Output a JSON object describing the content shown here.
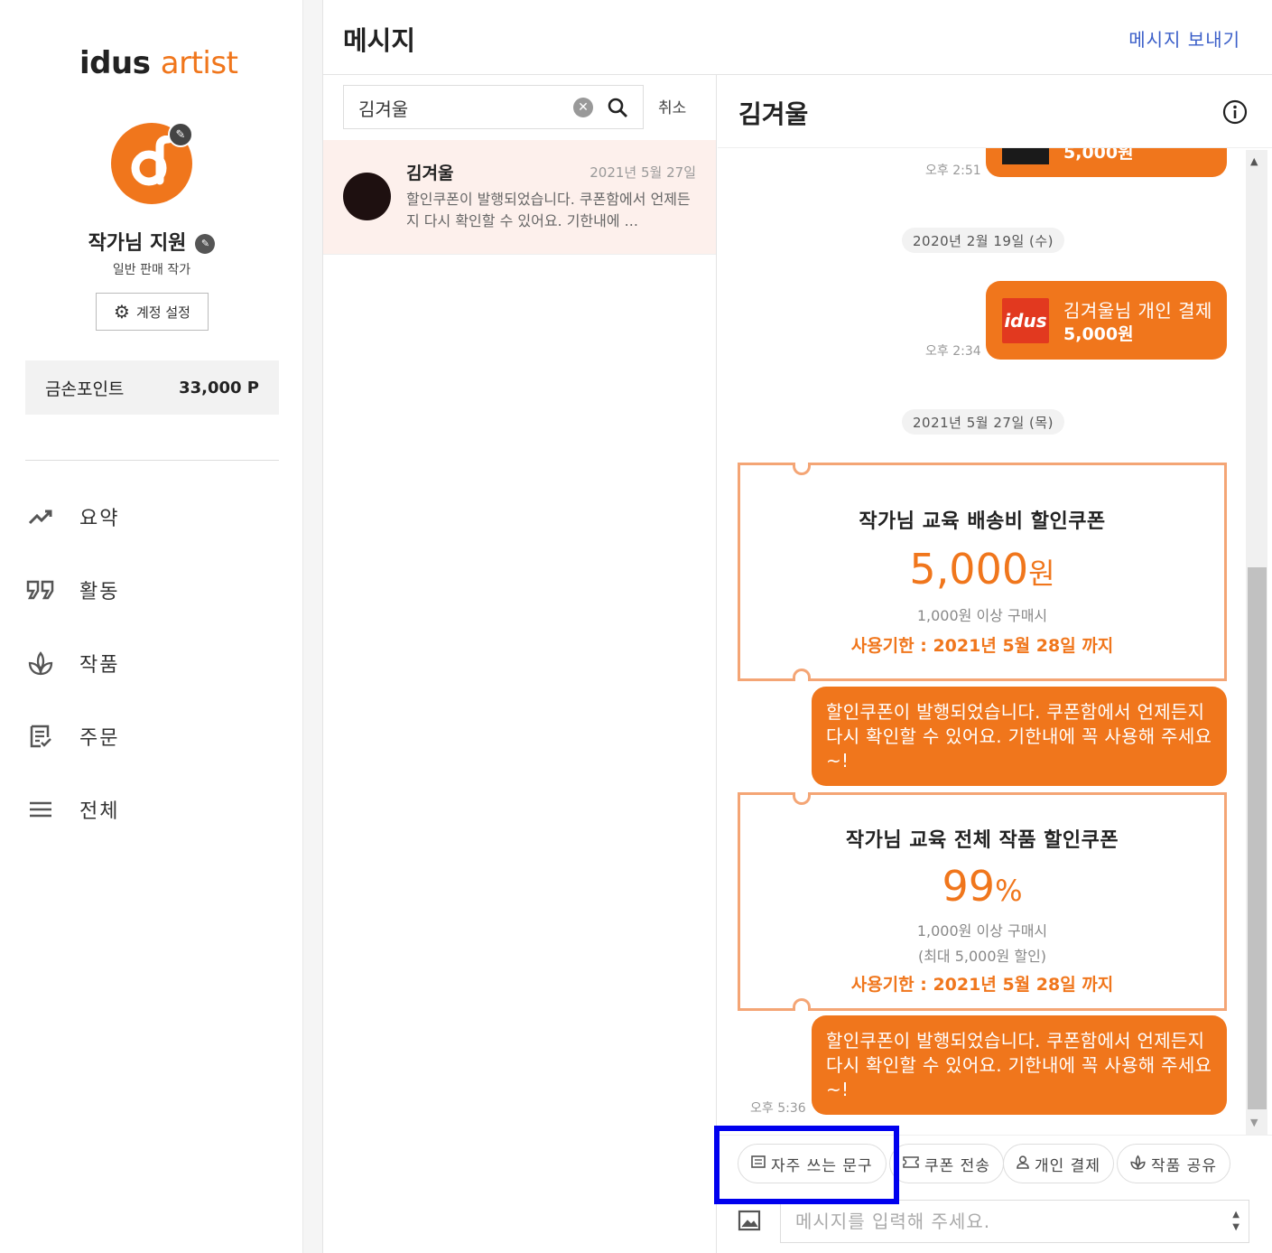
{
  "sidebar": {
    "logo_a": "idus",
    "logo_b": "artist",
    "artist_name": "작가님 지원",
    "artist_type": "일반 판매 작가",
    "account_settings": "계정 설정",
    "points_label": "금손포인트",
    "points_value": "33,000 P",
    "nav": [
      {
        "label": "요약",
        "icon": "trending-up-icon"
      },
      {
        "label": "활동",
        "icon": "quote-icon"
      },
      {
        "label": "작품",
        "icon": "plant-icon"
      },
      {
        "label": "주문",
        "icon": "order-list-icon"
      },
      {
        "label": "전체",
        "icon": "menu-icon"
      }
    ]
  },
  "header": {
    "title": "메시지",
    "send_link": "메시지 보내기"
  },
  "list": {
    "search_value": "김겨울",
    "cancel": "취소",
    "conversations": [
      {
        "name": "김겨울",
        "date": "2021년 5월 27일",
        "preview": "할인쿠폰이 발행되었습니다. 쿠폰함에서 언제든지 다시 확인할 수 있어요. 기한내에 ..."
      }
    ]
  },
  "chat": {
    "name": "김겨울",
    "top_bubble": {
      "amount": "5,000원",
      "time": "오후 2:51"
    },
    "date1": "2020년 2월 19일 (수)",
    "payment": {
      "logo": "idus",
      "title": "김겨울님 개인 결제",
      "amount": "5,000원",
      "time": "오후 2:34"
    },
    "date2": "2021년 5월 27일 (목)",
    "coupon1": {
      "title": "작가님 교육 배송비 할인쿠폰",
      "value": "5,000",
      "unit": "원",
      "condition": "1,000원 이상 구매시",
      "expiry": "사용기한 : 2021년 5월 28일 까지"
    },
    "notice1": "할인쿠폰이 발행되었습니다. 쿠폰함에서 언제든지 다시 확인할 수 있어요. 기한내에 꼭 사용해 주세요~!",
    "coupon2": {
      "title": "작가님 교육 전체 작품 할인쿠폰",
      "value": "99",
      "unit": "%",
      "condition": "1,000원 이상 구매시",
      "max": "(최대 5,000원 할인)",
      "expiry": "사용기한 : 2021년 5월 28일 까지"
    },
    "notice2": "할인쿠폰이 발행되었습니다. 쿠폰함에서 언제든지 다시 확인할 수 있어요. 기한내에 꼭 사용해 주세요~!",
    "notice2_time": "오후 5:36",
    "quick_actions": [
      "자주 쓰는 문구",
      "쿠폰 전송",
      "개인 결제",
      "작품 공유"
    ],
    "input_placeholder": "메시지를 입력해 주세요."
  },
  "colors": {
    "accent": "#f0761c",
    "link": "#3b5fc9",
    "highlight": "#0000ee"
  }
}
